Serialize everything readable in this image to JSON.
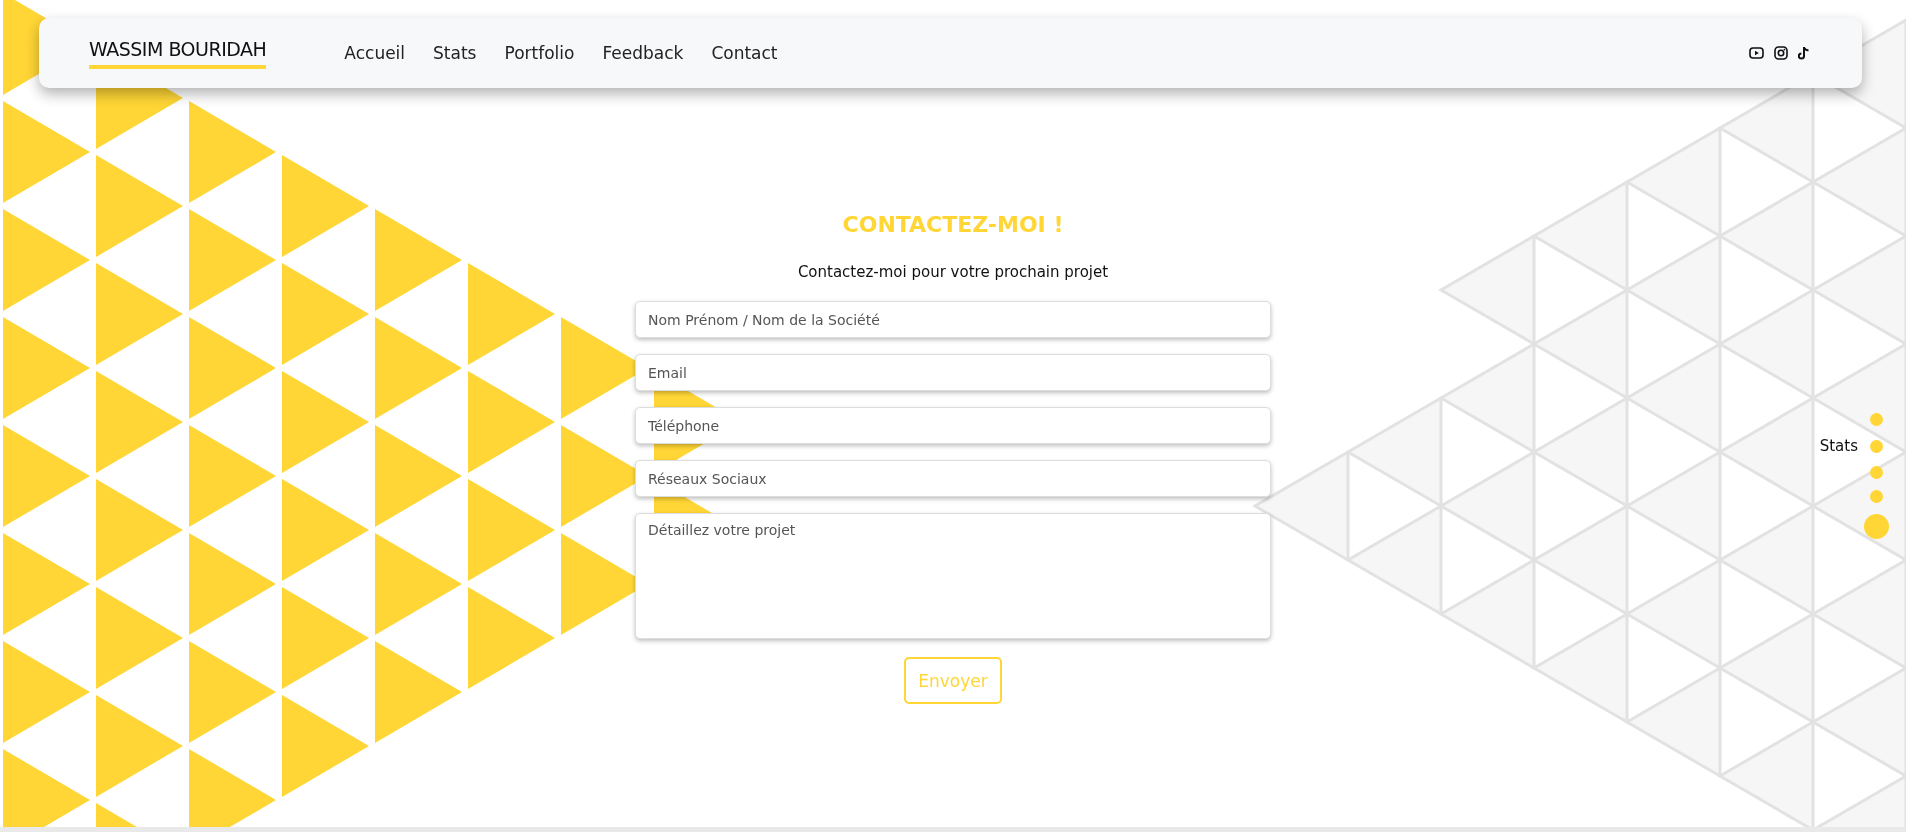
{
  "navbar": {
    "logo": "WASSIM BOURIDAH",
    "links": [
      {
        "label": "Accueil"
      },
      {
        "label": "Stats"
      },
      {
        "label": "Portfolio"
      },
      {
        "label": "Feedback"
      },
      {
        "label": "Contact"
      }
    ],
    "social_icons": [
      {
        "kind": "video"
      },
      {
        "kind": "camera"
      },
      {
        "kind": "note"
      }
    ]
  },
  "contact": {
    "title": "CONTACTEZ-MOI !",
    "subtitle": "Contactez-moi pour votre prochain projet",
    "fields": [
      {
        "kind": "input",
        "placeholder": "Nom Prénom / Nom de la Société"
      },
      {
        "kind": "input",
        "placeholder": "Email"
      },
      {
        "kind": "input",
        "placeholder": "Téléphone"
      },
      {
        "kind": "input",
        "placeholder": "Réseaux Sociaux"
      },
      {
        "kind": "textarea",
        "placeholder": "Détaillez votre projet"
      }
    ],
    "submit": "Envoyer"
  },
  "side_nav": [
    {
      "selected": false
    },
    {
      "label": "Stats",
      "selected": false
    },
    {
      "selected": false
    },
    {
      "selected": false
    },
    {
      "selected": true
    }
  ]
}
